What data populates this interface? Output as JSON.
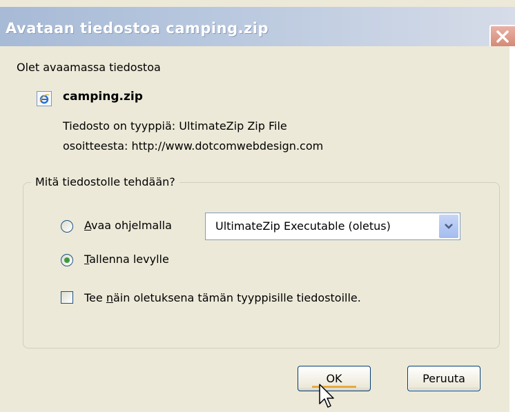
{
  "window": {
    "title": "Avataan tiedostoa camping.zip",
    "close_icon": "close-icon"
  },
  "intro": "Olet avaamassa tiedostoa",
  "file": {
    "icon": "internet-explorer-file-icon",
    "name": "camping.zip",
    "type_label": "Tiedosto on tyyppiä:",
    "type_value": "UltimateZip Zip File",
    "from_label": "osoitteesta:",
    "from_value": "http://www.dotcomwebdesign.com"
  },
  "group": {
    "legend": "Mitä tiedostolle tehdään?",
    "open_with": {
      "mnemonic": "A",
      "rest": "vaa ohjelmalla",
      "checked": false
    },
    "program_select": {
      "value": "UltimateZip Executable (oletus)"
    },
    "save": {
      "mnemonic": "T",
      "rest": "allenna levylle",
      "checked": true
    },
    "default_checkbox": {
      "prefix": "Tee ",
      "mnemonic": "n",
      "rest": "äin oletuksena tämän tyyppisille tiedostoille.",
      "checked": false
    }
  },
  "buttons": {
    "ok": "OK",
    "cancel": "Peruuta"
  },
  "colors": {
    "dialog_bg": "#ece9d8",
    "title_gradient_start": "#a7bad6",
    "radio_checked": "#3d9a3d",
    "default_button_highlight": "#e7a93e"
  }
}
